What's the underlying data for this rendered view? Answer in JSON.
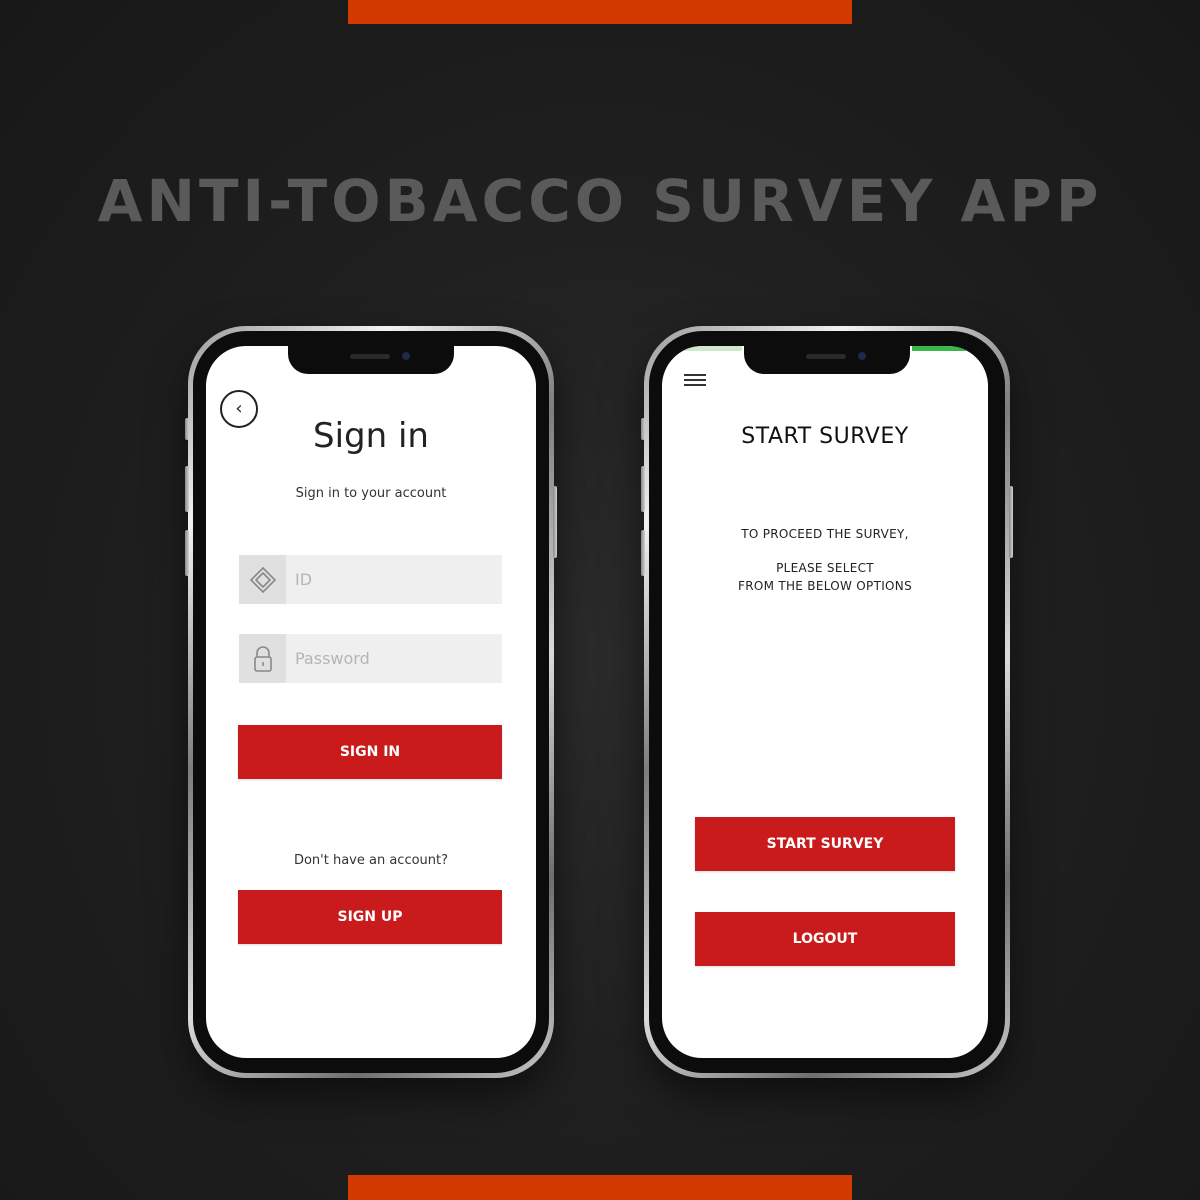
{
  "headline": "ANTI-TOBACCO SURVEY APP",
  "colors": {
    "accent": "#d33a02",
    "button_red": "#c91b1b",
    "headline_gray": "#5a5a5a",
    "status_green": "#3cb54a"
  },
  "sign_in_screen": {
    "back_icon": "chevron-left-icon",
    "back_glyph": "‹",
    "title": "Sign in",
    "subtitle": "Sign in to your account",
    "id_field": {
      "icon": "diamond-icon",
      "placeholder": "ID",
      "value": ""
    },
    "password_field": {
      "icon": "lock-icon",
      "placeholder": "Password",
      "value": ""
    },
    "sign_in_label": "SIGN IN",
    "signup_prompt": "Don't have an account?",
    "sign_up_label": "SIGN UP"
  },
  "survey_screen": {
    "menu_icon": "hamburger-menu-icon",
    "title": "START SURVEY",
    "message_line1": "TO PROCEED THE SURVEY,",
    "message_line2": "PLEASE SELECT",
    "message_line3": "FROM THE BELOW OPTIONS",
    "start_survey_label": "START SURVEY",
    "logout_label": "LOGOUT"
  }
}
